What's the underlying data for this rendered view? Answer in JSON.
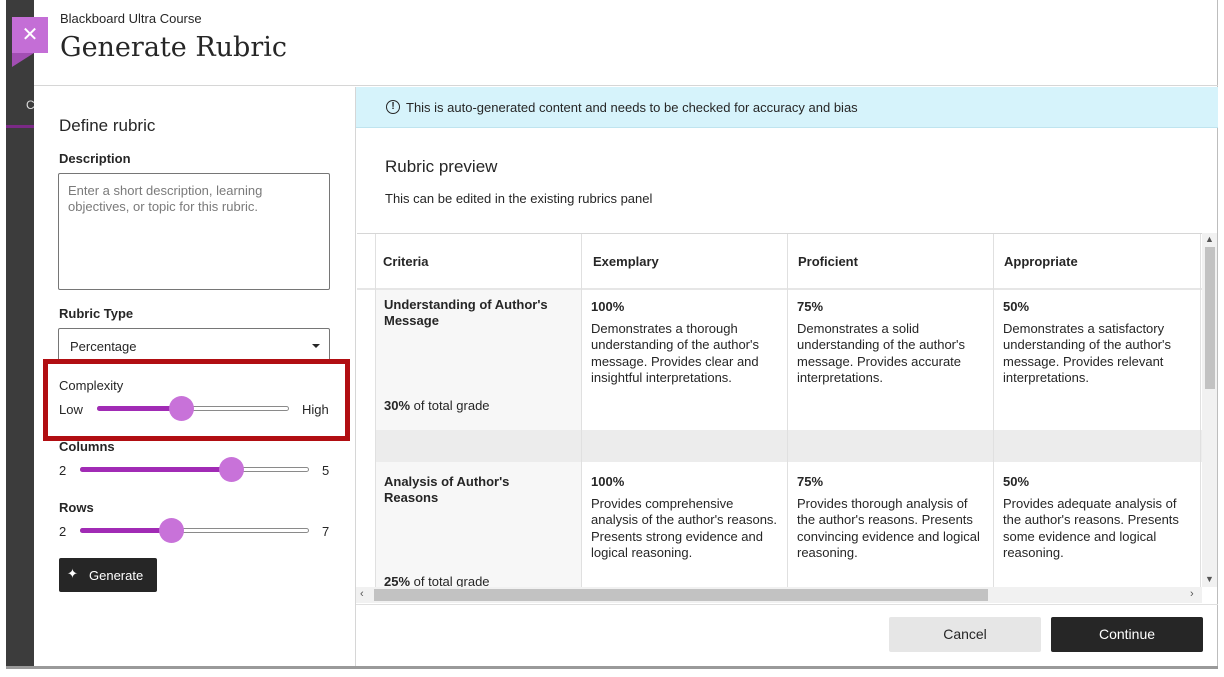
{
  "header": {
    "course_name": "Blackboard Ultra Course",
    "title": "Generate Rubric",
    "close_glyph": "✕"
  },
  "background": {
    "tab_letter": "C"
  },
  "define": {
    "title": "Define rubric",
    "description_label": "Description",
    "description_placeholder": "Enter a short description, learning objectives, or topic for this rubric.",
    "rubric_type_label": "Rubric Type",
    "rubric_type_value": "Percentage",
    "complexity": {
      "label": "Complexity",
      "min_label": "Low",
      "max_label": "High",
      "level_fraction": 0.44
    },
    "columns": {
      "label": "Columns",
      "min_label": "2",
      "max_label": "5",
      "level_fraction": 0.66
    },
    "rows": {
      "label": "Rows",
      "min_label": "2",
      "max_label": "7",
      "level_fraction": 0.4
    },
    "generate_label": "Generate"
  },
  "notice": {
    "text": "This is auto-generated content and needs to be checked for accuracy and bias"
  },
  "preview": {
    "title": "Rubric preview",
    "subtitle": "This can be edited in the existing rubrics panel",
    "headers": [
      "Criteria",
      "Exemplary",
      "Proficient",
      "Appropriate"
    ],
    "rows": [
      {
        "criteria": "Understanding of Author's Message",
        "weight": "30%",
        "weight_suffix": " of total grade",
        "cells": [
          {
            "pct": "100%",
            "desc": "Demonstrates a thorough understanding of the author's message. Provides clear and insightful interpretations."
          },
          {
            "pct": "75%",
            "desc": "Demonstrates a solid understanding of the author's message. Provides accurate interpretations."
          },
          {
            "pct": "50%",
            "desc": "Demonstrates a satisfactory understanding of the author's message. Provides relevant interpretations."
          }
        ]
      },
      {
        "criteria": "Analysis of Author's Reasons",
        "weight": "25%",
        "weight_suffix": " of total grade",
        "cells": [
          {
            "pct": "100%",
            "desc": "Provides comprehensive analysis of the author's reasons. Presents strong evidence and logical reasoning."
          },
          {
            "pct": "75%",
            "desc": "Provides thorough analysis of the author's reasons. Presents convincing evidence and logical reasoning."
          },
          {
            "pct": "50%",
            "desc": "Provides adequate analysis of the author's reasons. Presents some evidence and logical reasoning."
          }
        ]
      }
    ]
  },
  "footer": {
    "cancel_label": "Cancel",
    "continue_label": "Continue"
  },
  "colors": {
    "accent": "#a12bb5",
    "thumb": "#c872d9",
    "highlight": "#b10e12",
    "notice_bg": "#d6f3fb",
    "primary_button": "#262626"
  },
  "icons": {
    "close": "close-icon",
    "info": "info-icon",
    "generate": "sparkle-icon",
    "dropdown": "chevron-down-icon"
  }
}
